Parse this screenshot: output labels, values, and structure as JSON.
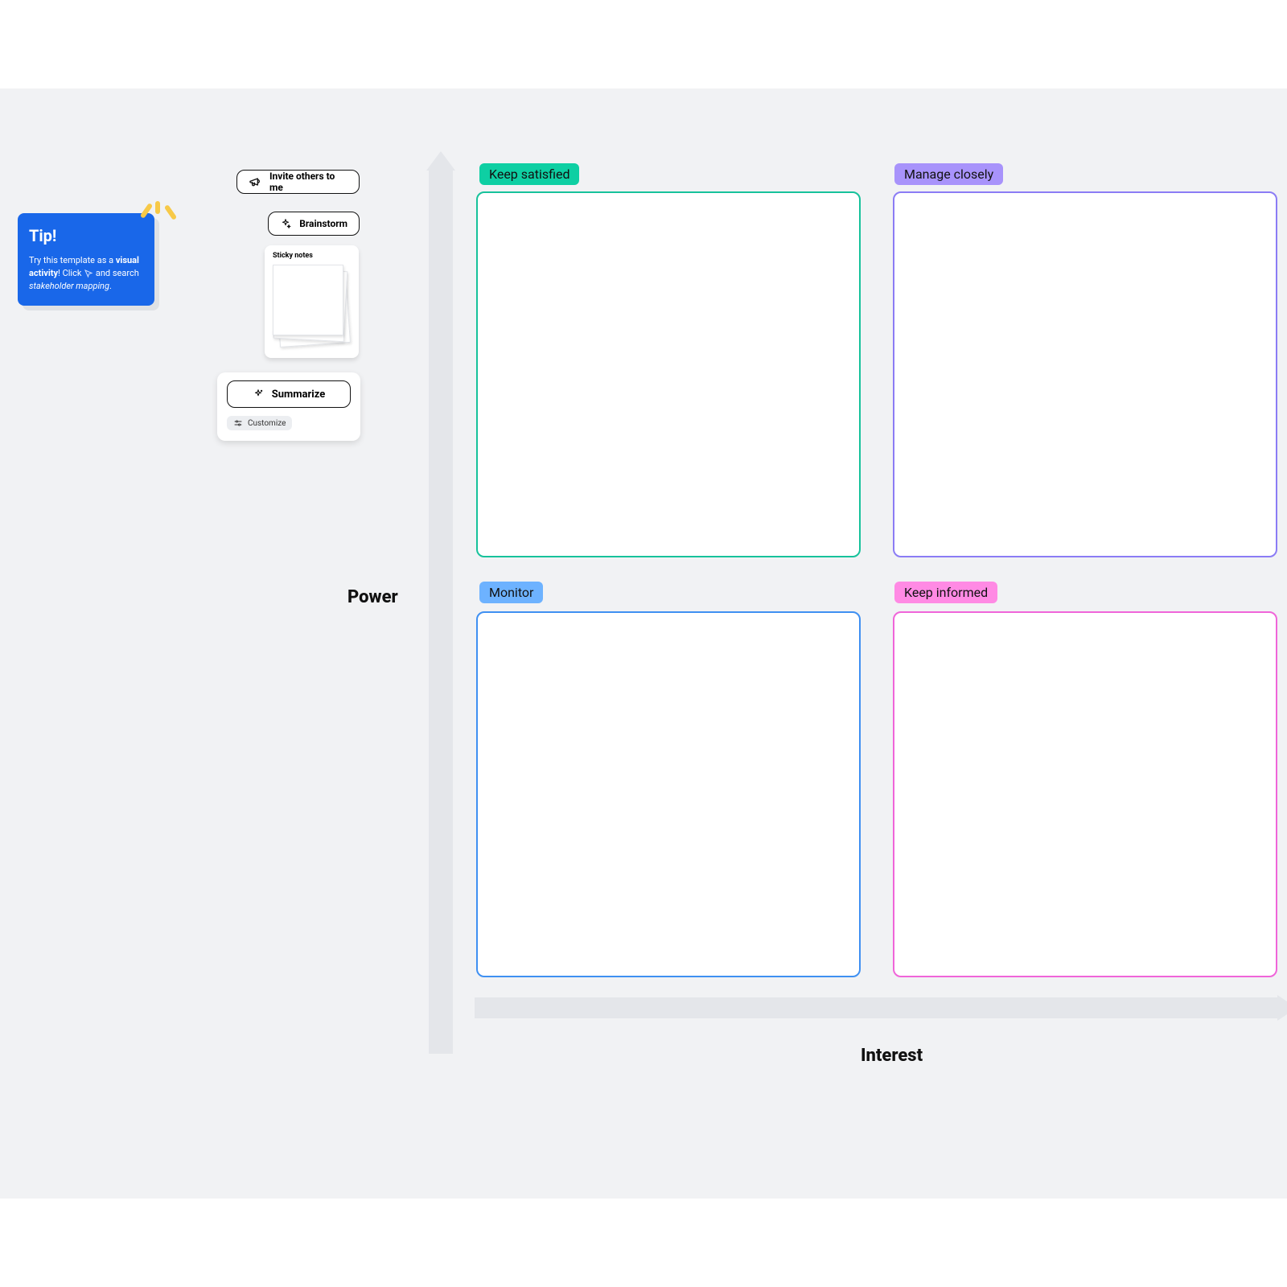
{
  "tip": {
    "title": "Tip!",
    "line1_prefix": "Try this template as a ",
    "line1_bold": "visual activity",
    "line1_suffix": "! Click ",
    "line2_prefix": "and search ",
    "line2_italic": "stakeholder mapping",
    "line2_suffix": "."
  },
  "buttons": {
    "invite": "Invite others to me",
    "brainstorm": "Brainstorm",
    "sticky_label": "Sticky notes",
    "summarize": "Summarize",
    "customize": "Customize"
  },
  "axes": {
    "y": "Power",
    "x": "Interest"
  },
  "quadrants": {
    "q1": "Keep satisfied",
    "q2": "Manage closely",
    "q3": "Monitor",
    "q4": "Keep informed"
  }
}
